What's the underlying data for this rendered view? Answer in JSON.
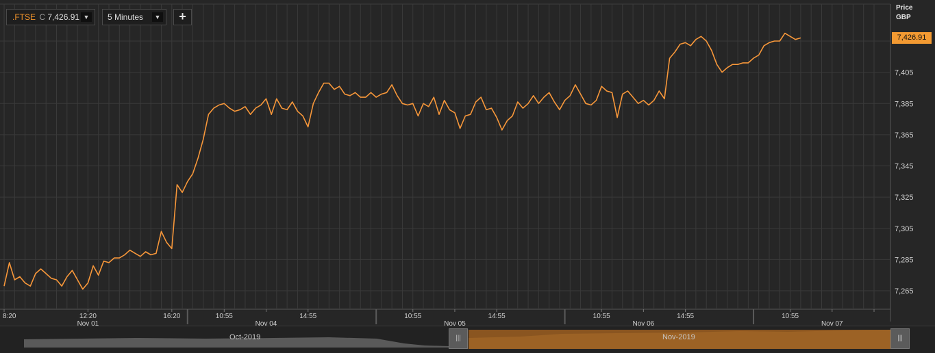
{
  "toolbar": {
    "symbol": ".FTSE",
    "close_flag": "C",
    "last_price": "7,426.91",
    "interval": "5 Minutes",
    "dropdown_glyph": "▼",
    "add_glyph": "+"
  },
  "y_axis_header": {
    "line1": "Price",
    "line2": "GBP"
  },
  "current_price_label": "7,426.91",
  "navigator": {
    "months": [
      "Oct-2019",
      "Nov-2019"
    ],
    "handle_glyph": "|||"
  },
  "colors": {
    "background": "#262626",
    "line": "#f7973a",
    "grid": "#3a3a3a",
    "accent": "#f39a32"
  },
  "chart_data": {
    "type": "line",
    "ylim": [
      7255,
      7440
    ],
    "y_ticks": [
      7265,
      7285,
      7305,
      7325,
      7345,
      7365,
      7385,
      7405
    ],
    "y_tick_labels": [
      "7,265",
      "7,285",
      "7,305",
      "7,325",
      "7,345",
      "7,365",
      "7,385",
      "7,405"
    ],
    "x_tick_labels": [
      {
        "time": "8:20",
        "date": "",
        "t": 0
      },
      {
        "time": "12:20",
        "date": "Nov 01",
        "t": 4
      },
      {
        "time": "16:20",
        "date": "",
        "t": 8
      },
      {
        "time": "10:55",
        "date": "",
        "t": 10.5
      },
      {
        "time": "",
        "date": "Nov 04",
        "t": 12.5
      },
      {
        "time": "14:55",
        "date": "",
        "t": 14.5
      },
      {
        "time": "10:55",
        "date": "",
        "t": 19.5
      },
      {
        "time": "",
        "date": "Nov 05",
        "t": 21.5
      },
      {
        "time": "14:55",
        "date": "",
        "t": 23.5
      },
      {
        "time": "10:55",
        "date": "",
        "t": 28.5
      },
      {
        "time": "",
        "date": "Nov 06",
        "t": 30.5
      },
      {
        "time": "14:55",
        "date": "",
        "t": 32.5
      },
      {
        "time": "10:55",
        "date": "",
        "t": 37.5
      },
      {
        "time": "",
        "date": "Nov 07",
        "t": 39.5
      },
      {
        "time": "",
        "date": "",
        "t": 41.5
      }
    ],
    "t_range": [
      0,
      41.5
    ],
    "series": [
      {
        "t": [
          0.0,
          0.25,
          0.5,
          0.75,
          1.0,
          1.25,
          1.5,
          1.75,
          2.0,
          2.25,
          2.5,
          2.75,
          3.0,
          3.25,
          3.5,
          3.75,
          4.0,
          4.25,
          4.5,
          4.75,
          5.0,
          5.25,
          5.5,
          5.75,
          6.0,
          6.25,
          6.5,
          6.75,
          7.0,
          7.25,
          7.5,
          7.75,
          8.0,
          8.25,
          8.5,
          8.75,
          9.0,
          9.25,
          9.5,
          9.75,
          10.0,
          10.25,
          10.5,
          10.75,
          11.0,
          11.25,
          11.5,
          11.75,
          12.0,
          12.25,
          12.5,
          12.75,
          13.0,
          13.25,
          13.5,
          13.75,
          14.0,
          14.25,
          14.5,
          14.75,
          15.0,
          15.25,
          15.5,
          15.75,
          16.0,
          16.25,
          16.5,
          16.75,
          17.0,
          17.25,
          17.5,
          17.75,
          18.0,
          18.25,
          18.5,
          18.75,
          19.0,
          19.25,
          19.5,
          19.75,
          20.0,
          20.25,
          20.5,
          20.75,
          21.0,
          21.25,
          21.5,
          21.75,
          22.0,
          22.25,
          22.5,
          22.75,
          23.0,
          23.25,
          23.5,
          23.75,
          24.0,
          24.25,
          24.5,
          24.75,
          25.0,
          25.25,
          25.5,
          25.75,
          26.0,
          26.25,
          26.5,
          26.75,
          27.0,
          27.25,
          27.5,
          27.75,
          28.0,
          28.25,
          28.5,
          28.75,
          29.0,
          29.25,
          29.5,
          29.75,
          30.0,
          30.25,
          30.5,
          30.75,
          31.0,
          31.25,
          31.5,
          31.75,
          32.0,
          32.25,
          32.5,
          32.75,
          33.0,
          33.25,
          33.5,
          33.75,
          34.0,
          34.25,
          34.5,
          34.75,
          35.0,
          35.25,
          35.5,
          35.75,
          36.0,
          36.25,
          36.5,
          36.75,
          37.0,
          37.25,
          37.5,
          37.75,
          38.0,
          38.25,
          38.5,
          38.75,
          39.0,
          39.25,
          39.5,
          39.75,
          40.0,
          40.25,
          40.5,
          40.75,
          41.0
        ],
        "values": [
          7268,
          7283,
          7272,
          7274,
          7270,
          7268,
          7276,
          7279,
          7276,
          7273,
          7272,
          7268,
          7274,
          7278,
          7272,
          7266,
          7270,
          7281,
          7275,
          7284,
          7283,
          7286,
          7286,
          7288,
          7291,
          7289,
          7287,
          7290,
          7288,
          7289,
          7303,
          7296,
          7292,
          7333,
          7328,
          7335,
          7340,
          7350,
          7362,
          7378,
          7382,
          7384,
          7385,
          7382,
          7380,
          7381,
          7383,
          7378,
          7382,
          7384,
          7388,
          7378,
          7388,
          7382,
          7381,
          7386,
          7380,
          7377,
          7370,
          7385,
          7392,
          7398,
          7398,
          7394,
          7396,
          7391,
          7390,
          7392,
          7389,
          7389,
          7392,
          7389,
          7391,
          7392,
          7397,
          7390,
          7385,
          7384,
          7385,
          7377,
          7385,
          7383,
          7389,
          7378,
          7387,
          7381,
          7379,
          7369,
          7377,
          7378,
          7386,
          7389,
          7381,
          7382,
          7376,
          7368,
          7374,
          7377,
          7386,
          7382,
          7385,
          7390,
          7385,
          7389,
          7392,
          7386,
          7381,
          7387,
          7390,
          7397,
          7391,
          7385,
          7384,
          7387,
          7396,
          7393,
          7392,
          7376,
          7391,
          7393,
          7389,
          7385,
          7387,
          7384,
          7387,
          7393,
          7388,
          7414,
          7418,
          7423,
          7424,
          7422,
          7426,
          7428,
          7425,
          7419,
          7410,
          7405,
          7408,
          7410,
          7410,
          7411,
          7411,
          7414,
          7416,
          7422,
          7424,
          7425,
          7425,
          7430,
          7428,
          7426,
          7427
        ]
      }
    ]
  }
}
